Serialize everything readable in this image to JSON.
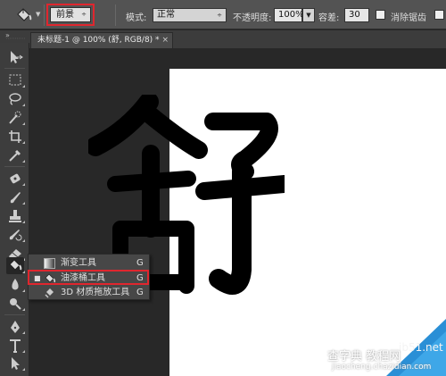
{
  "options_bar": {
    "fill_source": "前景",
    "mode_label": "模式:",
    "mode_value": "正常",
    "opacity_label": "不透明度:",
    "opacity_value": "100%",
    "tolerance_label": "容差:",
    "tolerance_value": "30",
    "antialias_label": "消除锯齿"
  },
  "document_tab": {
    "title": "未标题-1 @ 100% (舒, RGB/8) *",
    "close_glyph": "×"
  },
  "canvas": {
    "character": "舒"
  },
  "flyout": {
    "items": [
      {
        "label": "渐变工具",
        "shortcut": "G",
        "icon": "gradient-icon",
        "active": false
      },
      {
        "label": "油漆桶工具",
        "shortcut": "G",
        "icon": "paint-bucket-icon",
        "active": true
      },
      {
        "label": "3D 材质拖放工具",
        "shortcut": "G",
        "icon": "3d-material-drop-icon",
        "active": false
      }
    ],
    "active_marker": "■"
  },
  "watermark": {
    "site": "jb51.net",
    "line1": "查字典 教程网",
    "url": "jiaocheng.chazidian.com"
  },
  "colors": {
    "highlight": "#e0262e",
    "options_bar_bg": "#535353",
    "canvas": "#ffffff"
  }
}
